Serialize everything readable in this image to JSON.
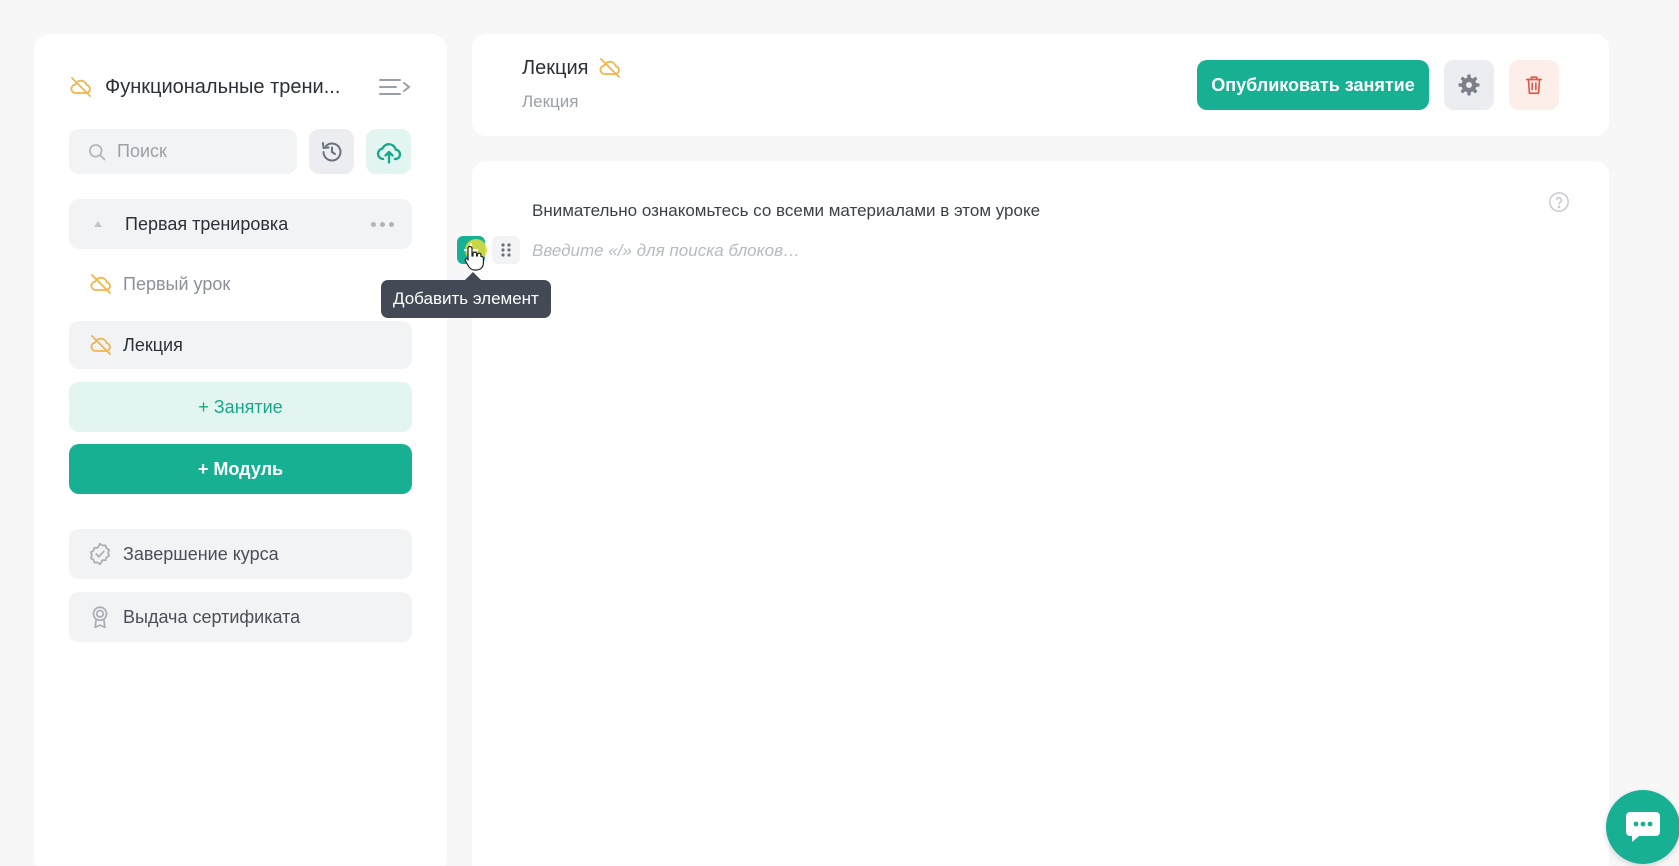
{
  "colors": {
    "accent": "#17b093",
    "accent_light": "#e3f5f1",
    "warning_icon": "#f2b54a",
    "danger": "#e05a4a",
    "tooltip_bg": "#434a55"
  },
  "sidebar": {
    "course_title": "Функциональные трени...",
    "search": {
      "placeholder": "Поиск",
      "value": ""
    },
    "module": {
      "title": "Первая тренировка"
    },
    "lessons": [
      {
        "label": "Первый урок",
        "icon": "eye-off-cloud-icon"
      },
      {
        "label": "Лекция",
        "icon": "eye-off-cloud-icon"
      }
    ],
    "add_lesson_label": "+ Занятие",
    "add_module_label": "+ Модуль",
    "extras": [
      {
        "label": "Завершение курса",
        "icon": "badge-check-icon"
      },
      {
        "label": "Выдача сертификата",
        "icon": "award-icon"
      }
    ]
  },
  "header": {
    "lesson_title": "Лекция",
    "lesson_subtitle": "Лекция",
    "publish_label": "Опубликовать занятие"
  },
  "editor": {
    "text": "Внимательно ознакомьтесь со всеми материалами в этом уроке",
    "placeholder": "Введите «/» для поиска блоков…",
    "tooltip": "Добавить элемент"
  }
}
